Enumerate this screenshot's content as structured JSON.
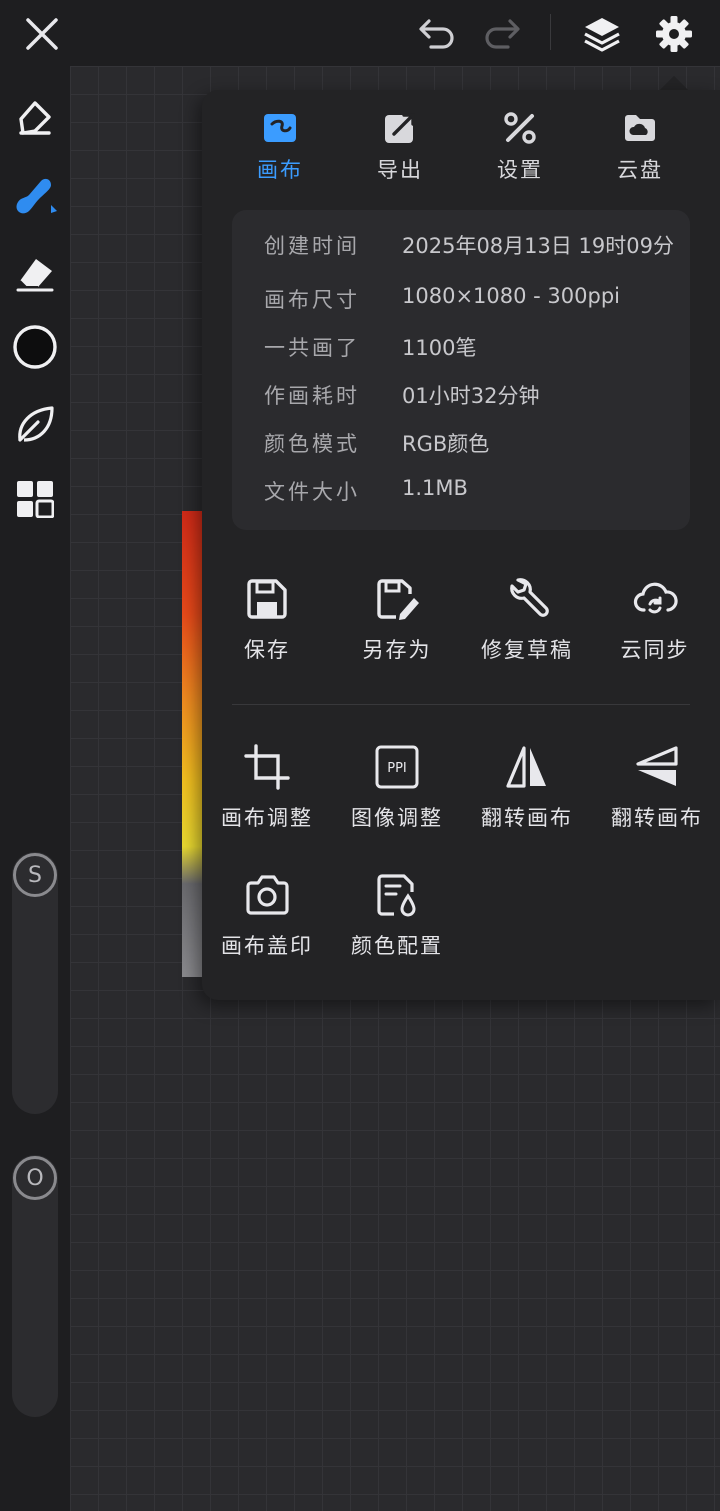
{
  "topbar": {
    "icons": [
      "close-icon",
      "undo-icon",
      "redo-icon",
      "layers-icon",
      "settings-gear-icon"
    ]
  },
  "lefttool": {
    "icons": [
      "pen-icon",
      "brush-icon",
      "eraser-icon",
      "color-circle-icon",
      "leaf-icon",
      "grid-icon"
    ],
    "slider_size_label": "S",
    "slider_opacity_label": "O"
  },
  "tabs": [
    {
      "label": "画布",
      "icon": "canvas-icon",
      "active": true
    },
    {
      "label": "导出",
      "icon": "export-icon",
      "active": false
    },
    {
      "label": "设置",
      "icon": "tools-icon",
      "active": false
    },
    {
      "label": "云盘",
      "icon": "cloud-drive-icon",
      "active": false
    }
  ],
  "info": {
    "created_key": "创建时间",
    "created_val": "2025年08月13日 19时09分",
    "size_key": "画布尺寸",
    "size_val": "1080×1080 - 300ppi",
    "strokes_key": "一共画了",
    "strokes_val": "1100笔",
    "duration_key": "作画耗时",
    "duration_val": "01小时32分钟",
    "colormode_key": "颜色模式",
    "colormode_val": "RGB颜色",
    "filesize_key": "文件大小",
    "filesize_val": "1.1MB"
  },
  "actions": {
    "save": "保存",
    "save_as": "另存为",
    "repair": "修复草稿",
    "cloud_sync": "云同步",
    "canvas_adjust": "画布调整",
    "image_adjust": "图像调整",
    "flip_h": "翻转画布",
    "flip_v": "翻转画布",
    "stamp": "画布盖印",
    "color_config": "颜色配置",
    "ppi_text": "PPI"
  },
  "colors": {
    "accent": "#3b9cff",
    "panel": "#232325",
    "background": "#2a2a2d"
  }
}
